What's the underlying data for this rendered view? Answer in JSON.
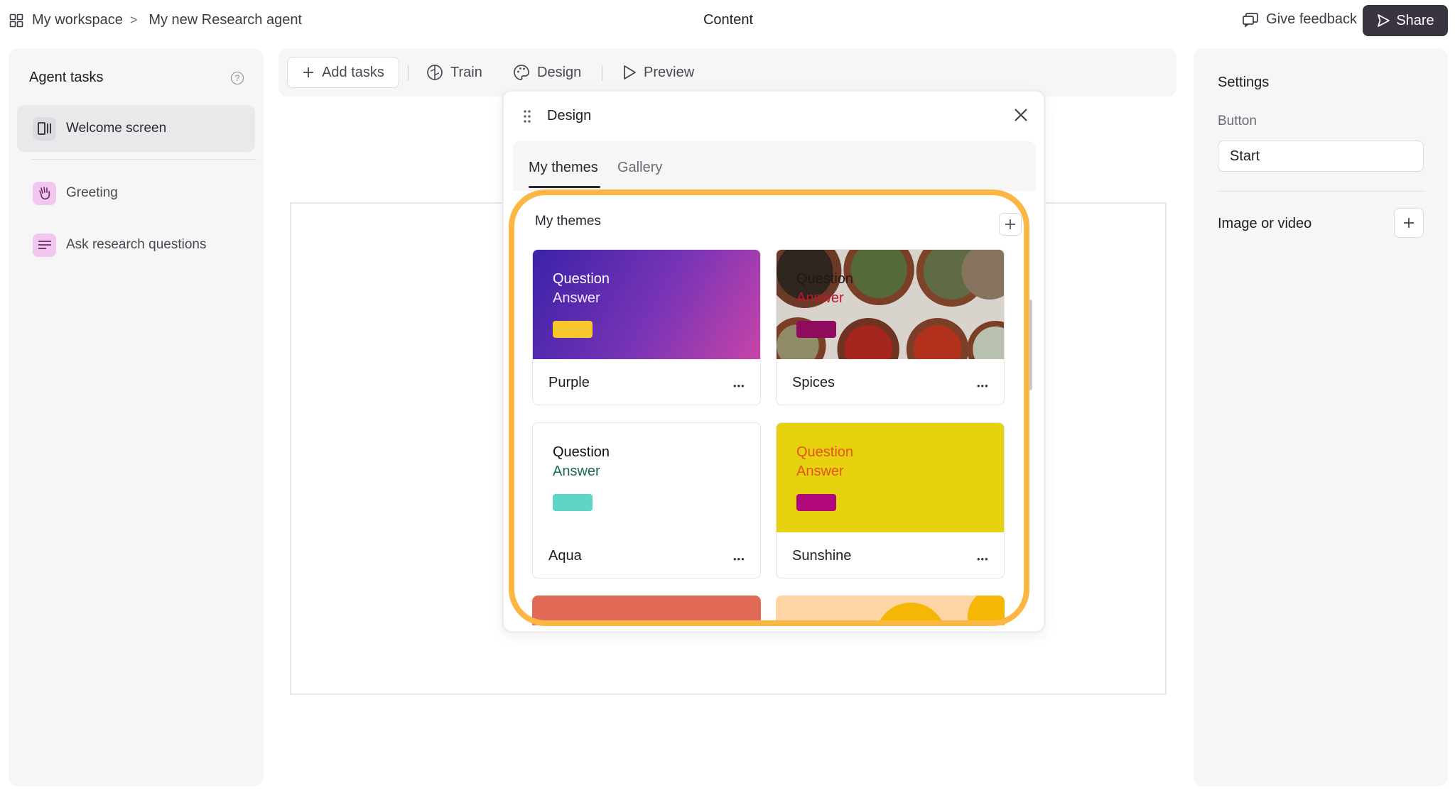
{
  "topbar": {
    "breadcrumb_workspace": "My workspace",
    "breadcrumb_sep": ">",
    "breadcrumb_agent": "My new Research agent",
    "center_title": "Content",
    "feedback_label": "Give feedback",
    "share_label": "Share"
  },
  "left_panel": {
    "title": "Agent tasks",
    "help_glyph": "?",
    "tasks": [
      {
        "label": "Welcome screen",
        "icon": "welcome-screen-icon",
        "active": true
      },
      {
        "label": "Greeting",
        "icon": "wave-hand-icon",
        "active": false
      },
      {
        "label": "Ask research questions",
        "icon": "lines-icon",
        "active": false
      }
    ]
  },
  "toolbar": {
    "add_tasks": "Add tasks",
    "train": "Train",
    "design": "Design",
    "preview": "Preview"
  },
  "design_modal": {
    "title": "Design",
    "tabs": [
      {
        "label": "My themes",
        "active": true
      },
      {
        "label": "Gallery",
        "active": false
      }
    ],
    "section_title": "My themes",
    "themes": [
      {
        "name": "Purple",
        "question": "Question",
        "answer": "Answer"
      },
      {
        "name": "Spices",
        "question": "Question",
        "answer": "Answer"
      },
      {
        "name": "Aqua",
        "question": "Question",
        "answer": "Answer"
      },
      {
        "name": "Sunshine",
        "question": "Question",
        "answer": "Answer"
      }
    ]
  },
  "settings": {
    "title": "Settings",
    "button_label": "Button",
    "button_value": "Start",
    "image_video_label": "Image or video"
  },
  "colors": {
    "highlight": "#fbb644",
    "share_bg": "#3a3440",
    "purple_theme": "#4b2bb0",
    "sunshine_theme": "#e6d20e",
    "aqua_swatch": "#5fd5c7"
  }
}
